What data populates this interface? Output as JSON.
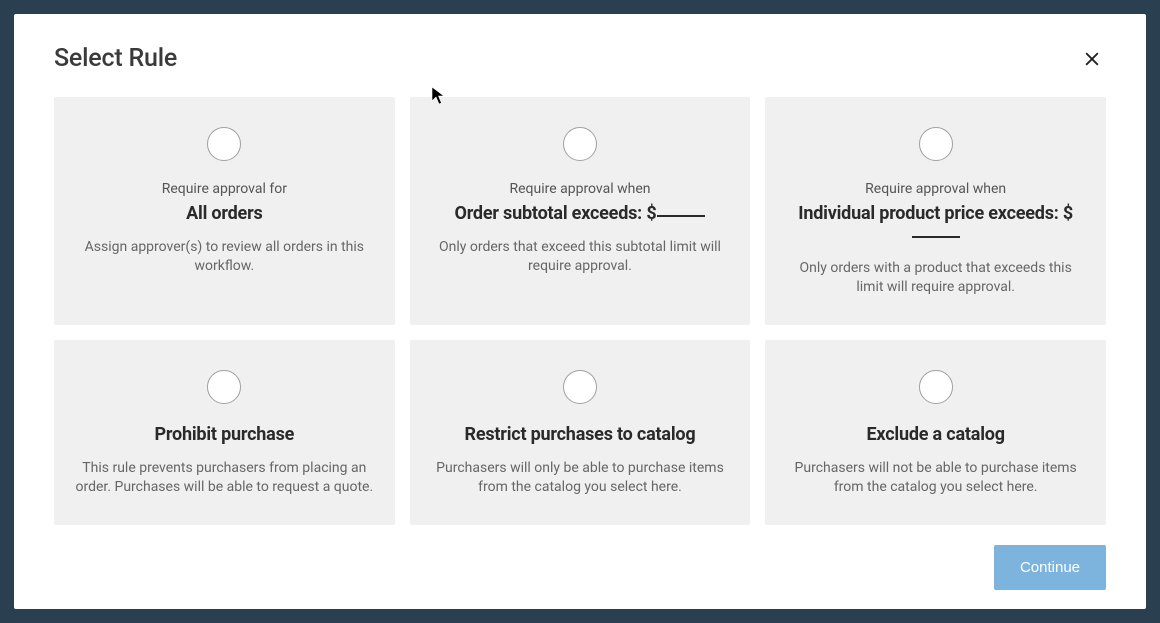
{
  "modal": {
    "title": "Select Rule",
    "continue_label": "Continue"
  },
  "rules": [
    {
      "prelabel": "Require approval for",
      "title": "All orders",
      "description": "Assign approver(s) to review all orders in this workflow."
    },
    {
      "prelabel": "Require approval when",
      "title_prefix": "Order subtotal exceeds: $",
      "description": "Only orders that exceed this subtotal limit will require approval."
    },
    {
      "prelabel": "Require approval when",
      "title_prefix": "Individual product price exceeds: $",
      "description": "Only orders with a product that exceeds this limit will require approval."
    },
    {
      "title": "Prohibit purchase",
      "description": "This rule prevents purchasers from placing an order. Purchases will be able to request a quote."
    },
    {
      "title": "Restrict purchases to catalog",
      "description": "Purchasers will only be able to purchase items from the catalog you select here."
    },
    {
      "title": "Exclude a catalog",
      "description": "Purchasers will not be able to purchase items from the catalog you select here."
    }
  ]
}
